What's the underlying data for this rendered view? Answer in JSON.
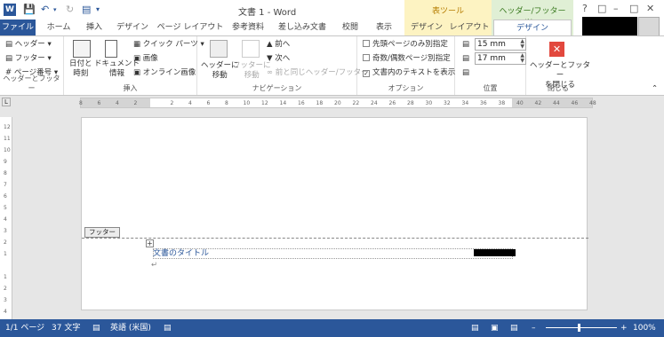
{
  "title": "文書 1 - Word",
  "context_groups": {
    "table_tools": "表ツール",
    "header_footer_tools": "ヘッダー/フッター ツ..."
  },
  "tabs": [
    "ファイル",
    "ホーム",
    "挿入",
    "デザイン",
    "ページ レイアウト",
    "参考資料",
    "差し込み文書",
    "校閲",
    "表示",
    "デザイン",
    "レイアウト",
    "デザイン"
  ],
  "ribbon": {
    "hf_group": {
      "header": "ヘッダー",
      "footer": "フッター",
      "page_number": "ページ番号",
      "label": "ヘッダーとフッター"
    },
    "insert_group": {
      "datetime": "日付と\n時刻",
      "docinfo": "ドキュメント\n情報",
      "quickparts": "クイック パーツ",
      "picture": "画像",
      "online_picture": "オンライン画像",
      "label": "挿入"
    },
    "nav_group": {
      "goto_header": "ヘッダーに\n移動",
      "goto_footer": "フッターに\n移動",
      "prev": "前へ",
      "next": "次へ",
      "link_prev": "前と同じヘッダー/フッター",
      "label": "ナビゲーション"
    },
    "options_group": {
      "first_page": "先頭ページのみ別指定",
      "odd_even": "奇数/偶数ページ別指定",
      "show_text": "文書内のテキストを表示",
      "label": "オプション"
    },
    "position_group": {
      "header_pos": "15 mm",
      "footer_pos": "17 mm",
      "label": "位置"
    },
    "close_group": {
      "close": "ヘッダーとフッター\nを閉じる",
      "label": "閉じる"
    }
  },
  "ruler_h": [
    "8",
    "6",
    "4",
    "2",
    "",
    "2",
    "4",
    "6",
    "8",
    "10",
    "12",
    "14",
    "16",
    "18",
    "20",
    "22",
    "24",
    "26",
    "28",
    "30",
    "32",
    "34",
    "36",
    "38",
    "40",
    "42",
    "44",
    "46",
    "48"
  ],
  "ruler_v": [
    "12",
    "11",
    "10",
    "9",
    "8",
    "7",
    "6",
    "5",
    "4",
    "3",
    "2",
    "1",
    "",
    "1",
    "2",
    "3",
    "4"
  ],
  "footer": {
    "tag": "フッター",
    "text": "文書のタイトル"
  },
  "status": {
    "page": "1/1 ページ",
    "words": "37 文字",
    "lang": "英語 (米国)",
    "zoom": "100%"
  },
  "colors": {
    "accent": "#2b579a",
    "table_tools": "#fdf3c2",
    "hf_tools": "#e0efd5",
    "close": "#e2483d"
  }
}
